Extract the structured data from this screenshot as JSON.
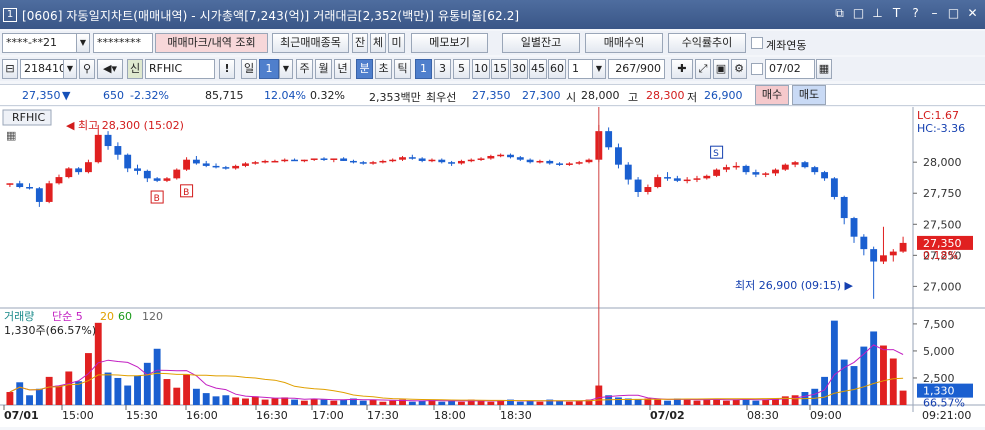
{
  "window": {
    "badge": "1",
    "title": "[0606] 자동일지차트(매매내역) - 시가총액[7,243(억)] 거래대금[2,352(백만)] 유통비율[62.2]",
    "icons": [
      "window-copy-icon",
      "window-new-icon",
      "pin-icon",
      "font-icon",
      "help-icon",
      "minimize-icon",
      "maximize-icon",
      "close-icon"
    ]
  },
  "toolbar1": {
    "account": "****-**21",
    "password": "********",
    "trade_mark_btn": "매매마크/내역 조회",
    "recent_btn": "최근매매종목",
    "jan_btn": "잔",
    "che_btn": "체",
    "mi_btn": "미",
    "memo_btn": "메모보기",
    "daily_balance_btn": "일별잔고",
    "trade_profit_btn": "매매수익",
    "return_trend_btn": "수익률추이",
    "account_link_label": "계좌연동"
  },
  "toolbar2": {
    "code": "218410",
    "new_label": "신",
    "stock_name": "RFHIC",
    "period_buttons": [
      "일",
      "1",
      "주",
      "월",
      "년",
      "분",
      "초",
      "틱"
    ],
    "interval_buttons": [
      "1",
      "3",
      "5",
      "10",
      "15",
      "30",
      "45",
      "60"
    ],
    "count": "1",
    "range": "267/900",
    "date": "07/02"
  },
  "quote": {
    "price": "27,350",
    "change": "650",
    "change_pct": "-2.32%",
    "volume": "85,715",
    "ratio1": "12.04%",
    "ratio2": "0.32%",
    "amount": "2,353백만",
    "best_label": "최우선",
    "best_ask": "27,350",
    "best_bid": "27,300",
    "open_label": "시",
    "open": "28,000",
    "high_label": "고",
    "high": "28,300",
    "low_label": "저",
    "low": "26,900",
    "buy_btn": "매수",
    "sell_btn": "매도"
  },
  "chart_data": {
    "type": "candlestick",
    "stock_label": "RFHIC",
    "price_axis": [
      28000,
      27750,
      27500,
      27250,
      27000
    ],
    "price_axis_labels": [
      "28,000",
      "27,750",
      "27,500",
      "27,250",
      "27,000"
    ],
    "current_price": "27,350",
    "current_pct": "0.18%",
    "lc_label": "LC:1.67",
    "hc_label": "HC:-3.36",
    "high_annotation": "최고 28,300 (15:02)",
    "low_annotation": "최저 26,900 (09:15)",
    "trade_marks": [
      "B",
      "B",
      "S"
    ],
    "time_labels": [
      "07/01",
      "15:00",
      "15:30",
      "16:00",
      "16:30",
      "17:00",
      "17:30",
      "18:00",
      "18:30",
      "07/02",
      "08:30",
      "09:00"
    ],
    "end_time": "09:21:00",
    "volume_legend": {
      "volume_label": "거래량",
      "ma_label": "단순",
      "ma_periods": [
        "5",
        "20",
        "60",
        "120"
      ],
      "ma_colors": [
        "#c21fc2",
        "#e0a000",
        "#1a9a1a",
        "#666666"
      ],
      "current": "1,330주(66.57%)"
    },
    "volume_axis_labels": [
      "7,500",
      "5,000",
      "2,500"
    ],
    "volume_axis_values": [
      7500,
      5000,
      2500
    ],
    "volume_current": "1,330",
    "volume_current_pct": "66.57%",
    "candles": [
      [
        27830,
        27830,
        27800,
        27830
      ],
      [
        27830,
        27850,
        27790,
        27800
      ],
      [
        27800,
        27830,
        27780,
        27790
      ],
      [
        27790,
        27800,
        27640,
        27680
      ],
      [
        27680,
        27850,
        27670,
        27830
      ],
      [
        27830,
        27900,
        27820,
        27880
      ],
      [
        27880,
        27960,
        27870,
        27950
      ],
      [
        27950,
        27960,
        27900,
        27920
      ],
      [
        27920,
        28020,
        27910,
        28000
      ],
      [
        28000,
        28300,
        27990,
        28220
      ],
      [
        28220,
        28250,
        28100,
        28130
      ],
      [
        28130,
        28160,
        28020,
        28060
      ],
      [
        28060,
        28070,
        27920,
        27950
      ],
      [
        27950,
        27980,
        27900,
        27930
      ],
      [
        27930,
        27940,
        27840,
        27870
      ],
      [
        27870,
        27880,
        27840,
        27850
      ],
      [
        27850,
        27880,
        27840,
        27870
      ],
      [
        27870,
        27950,
        27860,
        27940
      ],
      [
        27940,
        28040,
        27930,
        28020
      ],
      [
        28020,
        28050,
        27980,
        27990
      ],
      [
        27990,
        28010,
        27960,
        27970
      ],
      [
        27970,
        27990,
        27950,
        27960
      ],
      [
        27960,
        27970,
        27940,
        27950
      ],
      [
        27950,
        27980,
        27940,
        27970
      ],
      [
        27970,
        28000,
        27960,
        27990
      ],
      [
        27990,
        28010,
        27980,
        28000
      ],
      [
        28000,
        28020,
        27990,
        28010
      ],
      [
        28010,
        28020,
        28000,
        28010
      ],
      [
        28010,
        28030,
        28000,
        28020
      ],
      [
        28020,
        28030,
        28010,
        28010
      ],
      [
        28010,
        28020,
        28000,
        28020
      ],
      [
        28020,
        28030,
        28010,
        28030
      ],
      [
        28030,
        28040,
        28010,
        28020
      ],
      [
        28020,
        28030,
        28000,
        28030
      ],
      [
        28030,
        28040,
        28010,
        28010
      ],
      [
        28010,
        28020,
        27990,
        28000
      ],
      [
        28000,
        28010,
        27980,
        27990
      ],
      [
        27990,
        28010,
        27980,
        28000
      ],
      [
        28000,
        28020,
        27990,
        28010
      ],
      [
        28010,
        28030,
        28000,
        28020
      ],
      [
        28020,
        28050,
        28010,
        28040
      ],
      [
        28040,
        28060,
        28020,
        28030
      ],
      [
        28030,
        28040,
        28000,
        28010
      ],
      [
        28010,
        28030,
        28000,
        28020
      ],
      [
        28020,
        28030,
        27990,
        28000
      ],
      [
        28000,
        28010,
        27970,
        27990
      ],
      [
        27990,
        28020,
        27980,
        28010
      ],
      [
        28010,
        28030,
        28000,
        28020
      ],
      [
        28020,
        28040,
        28010,
        28030
      ],
      [
        28030,
        28060,
        28020,
        28050
      ],
      [
        28050,
        28070,
        28040,
        28060
      ],
      [
        28060,
        28070,
        28030,
        28040
      ],
      [
        28040,
        28050,
        28010,
        28020
      ],
      [
        28020,
        28030,
        27990,
        28000
      ],
      [
        28000,
        28020,
        27990,
        28010
      ],
      [
        28010,
        28020,
        27980,
        27990
      ],
      [
        27990,
        28000,
        27970,
        27980
      ],
      [
        27980,
        28000,
        27970,
        27990
      ],
      [
        27990,
        28010,
        27980,
        28000
      ],
      [
        28000,
        28030,
        27990,
        28020
      ],
      [
        28020,
        28300,
        28000,
        28250
      ],
      [
        28250,
        28280,
        28100,
        28120
      ],
      [
        28120,
        28150,
        27950,
        27980
      ],
      [
        27980,
        28000,
        27820,
        27860
      ],
      [
        27860,
        27880,
        27720,
        27760
      ],
      [
        27760,
        27820,
        27740,
        27800
      ],
      [
        27800,
        27900,
        27790,
        27880
      ],
      [
        27880,
        27920,
        27850,
        27870
      ],
      [
        27870,
        27890,
        27840,
        27850
      ],
      [
        27850,
        27880,
        27830,
        27860
      ],
      [
        27860,
        27890,
        27840,
        27870
      ],
      [
        27870,
        27900,
        27860,
        27890
      ],
      [
        27890,
        27950,
        27880,
        27940
      ],
      [
        27940,
        27980,
        27920,
        27960
      ],
      [
        27960,
        28000,
        27940,
        27970
      ],
      [
        27970,
        27980,
        27900,
        27920
      ],
      [
        27920,
        27940,
        27880,
        27900
      ],
      [
        27900,
        27920,
        27880,
        27910
      ],
      [
        27910,
        27950,
        27890,
        27940
      ],
      [
        27940,
        27990,
        27930,
        27980
      ],
      [
        27980,
        28010,
        27960,
        28000
      ],
      [
        28000,
        28010,
        27950,
        27960
      ],
      [
        27960,
        27970,
        27900,
        27920
      ],
      [
        27920,
        27930,
        27850,
        27870
      ],
      [
        27870,
        27880,
        27700,
        27720
      ],
      [
        27720,
        27730,
        27500,
        27550
      ],
      [
        27550,
        27560,
        27350,
        27400
      ],
      [
        27400,
        27420,
        27250,
        27300
      ],
      [
        27300,
        27320,
        26900,
        27200
      ],
      [
        27200,
        27480,
        27180,
        27250
      ],
      [
        27250,
        27300,
        27200,
        27280
      ],
      [
        27280,
        27400,
        27270,
        27350
      ]
    ],
    "volumes": [
      1200,
      2100,
      900,
      1500,
      2600,
      1800,
      3100,
      2200,
      4800,
      7600,
      3000,
      2500,
      1800,
      2700,
      3900,
      5200,
      2400,
      1600,
      2800,
      1500,
      1100,
      800,
      900,
      700,
      600,
      800,
      500,
      600,
      700,
      500,
      400,
      600,
      500,
      400,
      500,
      600,
      400,
      500,
      300,
      400,
      500,
      300,
      400,
      500,
      300,
      400,
      300,
      500,
      400,
      300,
      400,
      500,
      300,
      400,
      300,
      500,
      400,
      300,
      400,
      500,
      1800,
      900,
      700,
      600,
      500,
      600,
      500,
      400,
      600,
      500,
      400,
      600,
      500,
      400,
      500,
      600,
      400,
      500,
      600,
      800,
      900,
      1200,
      1500,
      2600,
      7800,
      4200,
      3600,
      5400,
      6800,
      5500,
      4300,
      1330
    ]
  }
}
